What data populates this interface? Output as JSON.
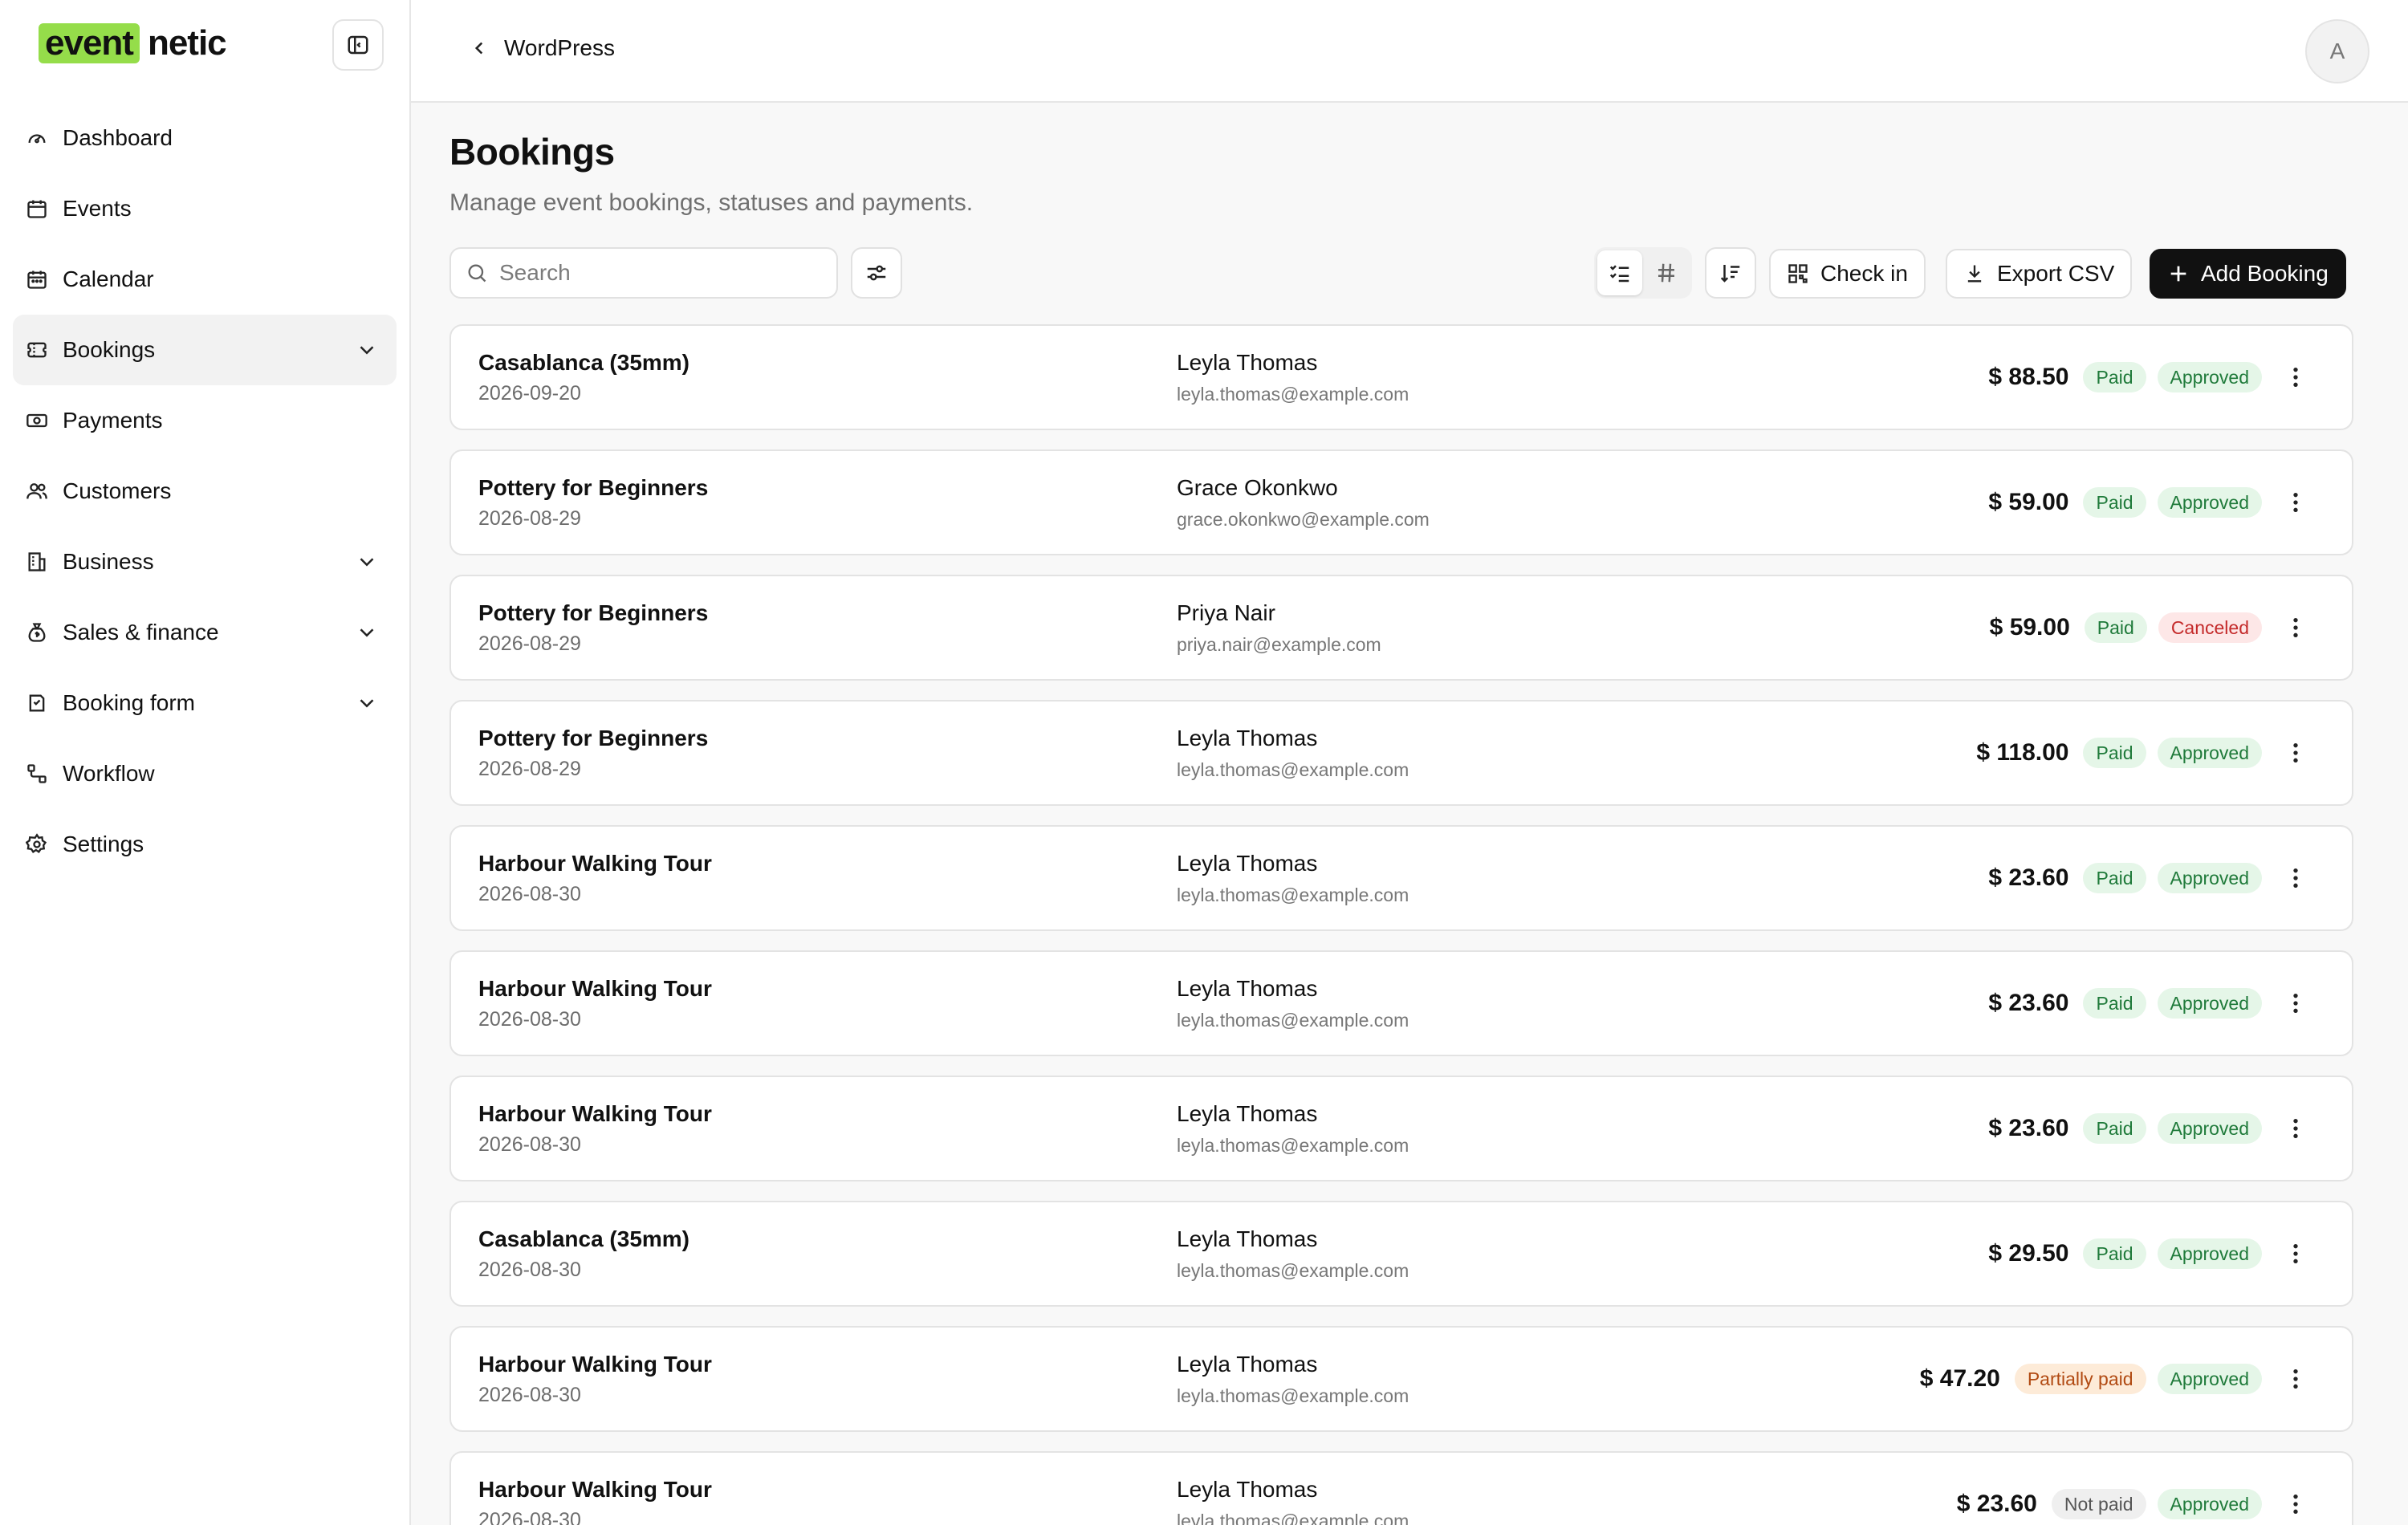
{
  "brand": {
    "logo_highlight": "event",
    "logo_rest": "netic"
  },
  "sidebar": {
    "items": [
      {
        "label": "Dashboard"
      },
      {
        "label": "Events"
      },
      {
        "label": "Calendar"
      },
      {
        "label": "Bookings"
      },
      {
        "label": "Payments"
      },
      {
        "label": "Customers"
      },
      {
        "label": "Business"
      },
      {
        "label": "Sales & finance"
      },
      {
        "label": "Booking form"
      },
      {
        "label": "Workflow"
      },
      {
        "label": "Settings"
      }
    ]
  },
  "topbar": {
    "back_label": "WordPress",
    "avatar_initial": "A"
  },
  "page": {
    "title": "Bookings",
    "subtitle": "Manage event bookings, statuses and payments."
  },
  "toolbar": {
    "search_placeholder": "Search",
    "check_in_label": "Check in",
    "export_label": "Export CSV",
    "add_label": "Add Booking"
  },
  "colors": {
    "accent": "#95dd4a",
    "primary": "#111111",
    "paid": "#1f7a3a",
    "canceled": "#c42a2a",
    "partial": "#b14a12"
  },
  "bookings": [
    {
      "event": "Casablanca (35mm)",
      "date": "2026-09-20",
      "customer": "Leyla Thomas",
      "email": "leyla.thomas@example.com",
      "amount": "$ 88.50",
      "payment": "Paid",
      "status": "Approved"
    },
    {
      "event": "Pottery for Beginners",
      "date": "2026-08-29",
      "customer": "Grace Okonkwo",
      "email": "grace.okonkwo@example.com",
      "amount": "$ 59.00",
      "payment": "Paid",
      "status": "Approved"
    },
    {
      "event": "Pottery for Beginners",
      "date": "2026-08-29",
      "customer": "Priya Nair",
      "email": "priya.nair@example.com",
      "amount": "$ 59.00",
      "payment": "Paid",
      "status": "Canceled"
    },
    {
      "event": "Pottery for Beginners",
      "date": "2026-08-29",
      "customer": "Leyla Thomas",
      "email": "leyla.thomas@example.com",
      "amount": "$ 118.00",
      "payment": "Paid",
      "status": "Approved"
    },
    {
      "event": "Harbour Walking Tour",
      "date": "2026-08-30",
      "customer": "Leyla Thomas",
      "email": "leyla.thomas@example.com",
      "amount": "$ 23.60",
      "payment": "Paid",
      "status": "Approved"
    },
    {
      "event": "Harbour Walking Tour",
      "date": "2026-08-30",
      "customer": "Leyla Thomas",
      "email": "leyla.thomas@example.com",
      "amount": "$ 23.60",
      "payment": "Paid",
      "status": "Approved"
    },
    {
      "event": "Harbour Walking Tour",
      "date": "2026-08-30",
      "customer": "Leyla Thomas",
      "email": "leyla.thomas@example.com",
      "amount": "$ 23.60",
      "payment": "Paid",
      "status": "Approved"
    },
    {
      "event": "Casablanca (35mm)",
      "date": "2026-08-30",
      "customer": "Leyla Thomas",
      "email": "leyla.thomas@example.com",
      "amount": "$ 29.50",
      "payment": "Paid",
      "status": "Approved"
    },
    {
      "event": "Harbour Walking Tour",
      "date": "2026-08-30",
      "customer": "Leyla Thomas",
      "email": "leyla.thomas@example.com",
      "amount": "$ 47.20",
      "payment": "Partially paid",
      "status": "Approved"
    },
    {
      "event": "Harbour Walking Tour",
      "date": "2026-08-30",
      "customer": "Leyla Thomas",
      "email": "leyla.thomas@example.com",
      "amount": "$ 23.60",
      "payment": "Not paid",
      "status": "Approved"
    }
  ]
}
